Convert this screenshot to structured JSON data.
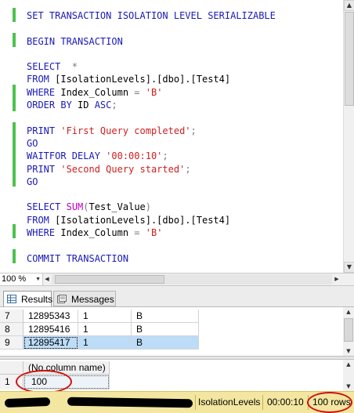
{
  "editor": {
    "lines": [
      {
        "segments": [
          {
            "t": "SET TRANSACTION ISOLATION LEVEL SERIALIZABLE",
            "c": "kw"
          }
        ]
      },
      {
        "segments": []
      },
      {
        "segments": [
          {
            "t": "BEGIN TRANSACTION",
            "c": "kw"
          }
        ]
      },
      {
        "segments": []
      },
      {
        "segments": [
          {
            "t": "SELECT",
            "c": "kw"
          },
          {
            "t": "  *",
            "c": "gray"
          }
        ]
      },
      {
        "segments": [
          {
            "t": "FROM",
            "c": "kw"
          },
          {
            "t": " [IsolationLevels].[dbo].[Test4]",
            "c": ""
          }
        ]
      },
      {
        "segments": [
          {
            "t": "WHERE",
            "c": "kw"
          },
          {
            "t": " Index_Column ",
            "c": ""
          },
          {
            "t": "=",
            "c": "gray"
          },
          {
            "t": " ",
            "c": ""
          },
          {
            "t": "'B'",
            "c": "str"
          }
        ]
      },
      {
        "segments": [
          {
            "t": "ORDER BY",
            "c": "kw"
          },
          {
            "t": " ID ",
            "c": ""
          },
          {
            "t": "ASC",
            "c": "kw"
          },
          {
            "t": ";",
            "c": "gray"
          }
        ]
      },
      {
        "segments": []
      },
      {
        "segments": [
          {
            "t": "PRINT",
            "c": "kw"
          },
          {
            "t": " ",
            "c": ""
          },
          {
            "t": "'First Query completed'",
            "c": "str"
          },
          {
            "t": ";",
            "c": "gray"
          }
        ]
      },
      {
        "segments": [
          {
            "t": "GO",
            "c": "kw"
          }
        ]
      },
      {
        "segments": [
          {
            "t": "WAITFOR DELAY",
            "c": "kw"
          },
          {
            "t": " ",
            "c": ""
          },
          {
            "t": "'00:00:10'",
            "c": "str"
          },
          {
            "t": ";",
            "c": "gray"
          }
        ]
      },
      {
        "segments": [
          {
            "t": "PRINT",
            "c": "kw"
          },
          {
            "t": " ",
            "c": ""
          },
          {
            "t": "'Second Query started'",
            "c": "str"
          },
          {
            "t": ";",
            "c": "gray"
          }
        ]
      },
      {
        "segments": [
          {
            "t": "GO",
            "c": "kw"
          }
        ]
      },
      {
        "segments": []
      },
      {
        "segments": [
          {
            "t": "SELECT",
            "c": "kw"
          },
          {
            "t": " ",
            "c": ""
          },
          {
            "t": "SUM",
            "c": "fn"
          },
          {
            "t": "(",
            "c": "gray"
          },
          {
            "t": "Test_Value",
            "c": ""
          },
          {
            "t": ")",
            "c": "gray"
          }
        ]
      },
      {
        "segments": [
          {
            "t": "FROM",
            "c": "kw"
          },
          {
            "t": " [IsolationLevels].[dbo].[Test4]",
            "c": ""
          }
        ]
      },
      {
        "segments": [
          {
            "t": "WHERE",
            "c": "kw"
          },
          {
            "t": " Index_Column ",
            "c": ""
          },
          {
            "t": "=",
            "c": "gray"
          },
          {
            "t": " ",
            "c": ""
          },
          {
            "t": "'B'",
            "c": "str"
          }
        ]
      },
      {
        "segments": []
      },
      {
        "segments": [
          {
            "t": "COMMIT TRANSACTION",
            "c": "kw"
          }
        ]
      }
    ]
  },
  "zoom": {
    "label": "100 %"
  },
  "tabs": {
    "results": "Results",
    "messages": "Messages"
  },
  "results_grid": {
    "rows": [
      {
        "row": "7",
        "id": "12895343",
        "value": "1",
        "index": "B",
        "selected": false
      },
      {
        "row": "8",
        "id": "12895416",
        "value": "1",
        "index": "B",
        "selected": false
      },
      {
        "row": "9",
        "id": "12895417",
        "value": "1",
        "index": "B",
        "selected": true
      }
    ]
  },
  "sum_grid": {
    "header": "(No column name)",
    "row_number": "1",
    "value": "100"
  },
  "status": {
    "database": "IsolationLevels",
    "elapsed": "00:00:10",
    "rows": "100 rows"
  },
  "colors": {
    "keyword": "#1a1ab8",
    "string": "#cc1f1f",
    "function": "#c000c0",
    "change_marker": "#4ec24e",
    "status_bar": "#f3e6a0",
    "highlight_ellipse": "#d01010",
    "selected_row": "#bcdcf8"
  }
}
